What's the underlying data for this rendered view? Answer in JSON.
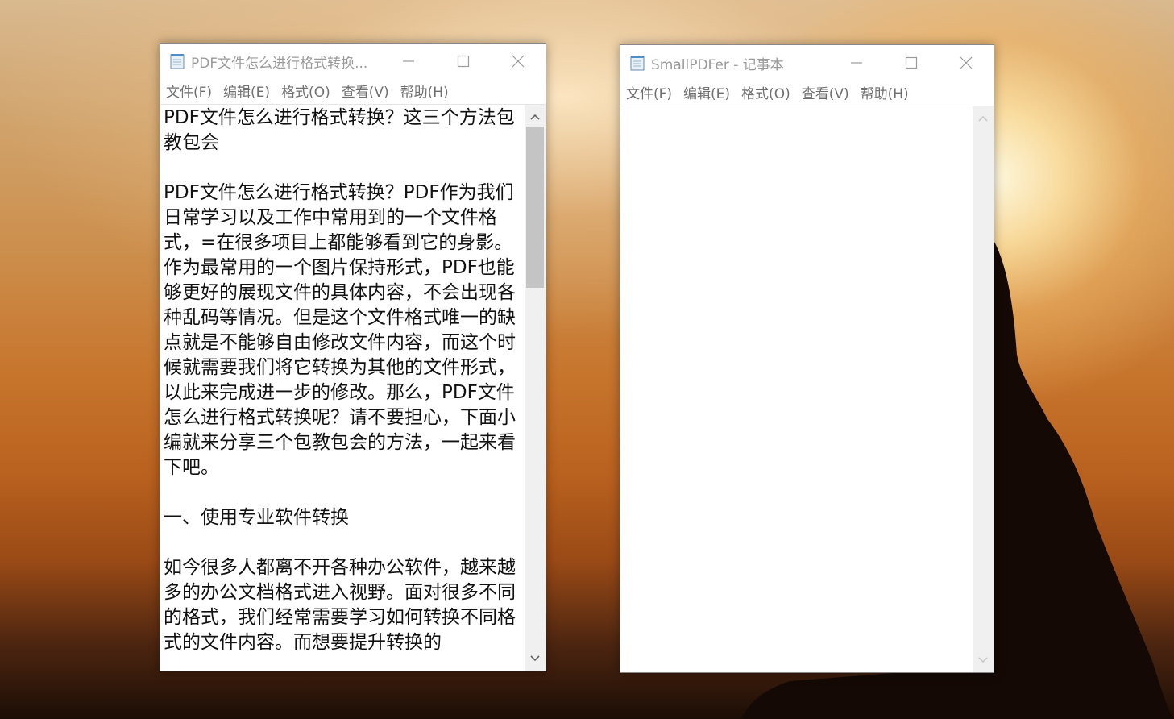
{
  "windows": [
    {
      "title": "PDF文件怎么进行格式转换...",
      "menu": [
        "文件(F)",
        "编辑(E)",
        "格式(O)",
        "查看(V)",
        "帮助(H)"
      ],
      "content": "PDF文件怎么进行格式转换？这三个方法包教包会\n\nPDF文件怎么进行格式转换？PDF作为我们日常学习以及工作中常用到的一个文件格式，=在很多项目上都能够看到它的身影。作为最常用的一个图片保持形式，PDF也能够更好的展现文件的具体内容，不会出现各种乱码等情况。但是这个文件格式唯一的缺点就是不能够自由修改文件内容，而这个时候就需要我们将它转换为其他的文件形式，以此来完成进一步的修改。那么，PDF文件怎么进行格式转换呢？请不要担心，下面小编就来分享三个包教包会的方法，一起来看下吧。\n\n一、使用专业软件转换\n\n如今很多人都离不开各种办公软件，越来越多的办公文档格式进入视野。面对很多不同的格式，我们经常需要学习如何转换不同格式的文件内容。而想要提升转换的"
    },
    {
      "title": "SmallPDFer - 记事本",
      "menu": [
        "文件(F)",
        "编辑(E)",
        "格式(O)",
        "查看(V)",
        "帮助(H)"
      ],
      "content": ""
    }
  ],
  "icons": {
    "app": "notepad-icon",
    "minimize": "minimize-icon",
    "maximize": "maximize-icon",
    "close": "close-icon",
    "scroll_up": "scroll-up-arrow-icon",
    "scroll_down": "scroll-down-arrow-icon"
  },
  "colors": {
    "title_inactive": "#9a9a9a",
    "menu_text": "#6f6f6f",
    "scrollbar_track": "#f0f0f0",
    "scrollbar_thumb": "#c4c4c4"
  }
}
